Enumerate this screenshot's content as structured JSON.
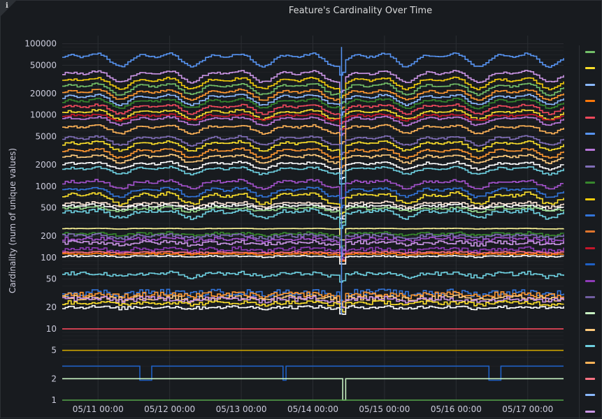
{
  "panel": {
    "title": "Feature's Cardinality Over Time",
    "info_icon": "i"
  },
  "chart_data": {
    "type": "line",
    "title": "Feature's Cardinality Over Time",
    "xlabel": "",
    "ylabel": "Cardinality (num of unique values)",
    "yscale": "log",
    "ylim": [
      1,
      130000
    ],
    "yticks": [
      1,
      2,
      5,
      10,
      20,
      50,
      100,
      200,
      500,
      1000,
      2000,
      5000,
      10000,
      20000,
      50000,
      100000
    ],
    "ytick_labels": [
      "1",
      "2",
      "5",
      "10",
      "20",
      "50",
      "100",
      "200",
      "500",
      "1000",
      "2000",
      "5000",
      "10000",
      "20000",
      "50000",
      "100000"
    ],
    "x_start": "05/10 12:00",
    "xlim_days": [
      0,
      7.0
    ],
    "xticks": [
      {
        "label": "05/11 00:00",
        "day": 0.5
      },
      {
        "label": "05/12 00:00",
        "day": 1.5
      },
      {
        "label": "05/13 00:00",
        "day": 2.5
      },
      {
        "label": "05/14 00:00",
        "day": 3.5
      },
      {
        "label": "05/15 00:00",
        "day": 4.5
      },
      {
        "label": "05/16 00:00",
        "day": 5.5
      },
      {
        "label": "05/17 00:00",
        "day": 6.5
      }
    ],
    "grid": true,
    "legend": "right",
    "series": [
      {
        "color": "#5794f2",
        "base": 62000,
        "amp": 0.26,
        "noise": 0.03
      },
      {
        "color": "#ca95e5",
        "base": 36000,
        "amp": 0.22,
        "noise": 0.03
      },
      {
        "color": "#f2cc0c",
        "base": 29000,
        "amp": 0.22,
        "noise": 0.03
      },
      {
        "color": "#73bf69",
        "base": 24000,
        "amp": 0.22,
        "noise": 0.03
      },
      {
        "color": "#ff9830",
        "base": 20000,
        "amp": 0.2,
        "noise": 0.03
      },
      {
        "color": "#8ab8ff",
        "base": 17000,
        "amp": 0.2,
        "noise": 0.03
      },
      {
        "color": "#37872d",
        "base": 15000,
        "amp": 0.18,
        "noise": 0.03
      },
      {
        "color": "#f2495c",
        "base": 12500,
        "amp": 0.18,
        "noise": 0.03
      },
      {
        "color": "#fade2a",
        "base": 10500,
        "amp": 0.18,
        "noise": 0.03
      },
      {
        "color": "#c4162a",
        "base": 9500,
        "amp": 0.12,
        "noise": 0.03
      },
      {
        "color": "#b877d9",
        "base": 8500,
        "amp": 0.16,
        "noise": 0.03
      },
      {
        "color": "#ffb357",
        "base": 6500,
        "amp": 0.16,
        "noise": 0.03
      },
      {
        "color": "#806eb7",
        "base": 4500,
        "amp": 0.18,
        "noise": 0.03
      },
      {
        "color": "#fade2a",
        "base": 3800,
        "amp": 0.18,
        "noise": 0.03
      },
      {
        "color": "#ff9830",
        "base": 3000,
        "amp": 0.18,
        "noise": 0.03
      },
      {
        "color": "#ffcb7d",
        "base": 2500,
        "amp": 0.16,
        "noise": 0.03
      },
      {
        "color": "#ffffff",
        "base": 2000,
        "amp": 0.14,
        "noise": 0.03
      },
      {
        "color": "#6ed0e0",
        "base": 1700,
        "amp": 0.14,
        "noise": 0.03
      },
      {
        "color": "#a352cc",
        "base": 1100,
        "amp": 0.16,
        "noise": 0.04
      },
      {
        "color": "#3274d9",
        "base": 850,
        "amp": 0.18,
        "noise": 0.04
      },
      {
        "color": "#fade2a",
        "base": 700,
        "amp": 0.22,
        "noise": 0.05
      },
      {
        "color": "#f9e2d2",
        "base": 560,
        "amp": 0.1,
        "noise": 0.04
      },
      {
        "color": "#ffffff",
        "base": 520,
        "amp": 0.1,
        "noise": 0.04
      },
      {
        "color": "#96d98d",
        "base": 480,
        "amp": 0.08,
        "noise": 0.04
      },
      {
        "color": "#6ed0e0",
        "base": 420,
        "amp": 0.16,
        "noise": 0.05
      },
      {
        "color": "#fff899",
        "base": 255,
        "amp": 0.01,
        "noise": 0.005
      },
      {
        "color": "#37872d",
        "base": 215,
        "amp": 0.05,
        "noise": 0.04
      },
      {
        "color": "#806eb7",
        "base": 200,
        "amp": 0.06,
        "noise": 0.05
      },
      {
        "color": "#a352cc",
        "base": 180,
        "amp": 0.05,
        "noise": 0.05
      },
      {
        "color": "#ca95e5",
        "base": 160,
        "amp": 0.05,
        "noise": 0.06
      },
      {
        "color": "#8f3bb8",
        "base": 130,
        "amp": 0.05,
        "noise": 0.06
      },
      {
        "color": "#ff7383",
        "base": 118,
        "amp": 0.02,
        "noise": 0.02
      },
      {
        "color": "#ff780a",
        "base": 112,
        "amp": 0.02,
        "noise": 0.02
      },
      {
        "color": "#ffffff",
        "base": 104,
        "amp": 0.02,
        "noise": 0.02
      },
      {
        "color": "#6ed0e0",
        "base": 58,
        "amp": 0.08,
        "noise": 0.06
      },
      {
        "color": "#3274d9",
        "base": 32,
        "amp": 0.05,
        "noise": 0.1
      },
      {
        "color": "#ff9830",
        "base": 30,
        "amp": 0.05,
        "noise": 0.08
      },
      {
        "color": "#ffcb7d",
        "base": 27,
        "amp": 0.04,
        "noise": 0.08
      },
      {
        "color": "#ca95e5",
        "base": 26,
        "amp": 0.04,
        "noise": 0.08
      },
      {
        "color": "#fade2a",
        "base": 23,
        "amp": 0.04,
        "noise": 0.06
      },
      {
        "color": "#ffffff",
        "base": 20,
        "amp": 0.03,
        "noise": 0.05
      },
      {
        "color": "#f2495c",
        "base": 10,
        "amp": 0,
        "noise": 0
      },
      {
        "color": "#cca300",
        "base": 5,
        "amp": 0,
        "noise": 0
      },
      {
        "color": "#1f60c4",
        "base": 3,
        "amp": 0,
        "noise": 0
      },
      {
        "color": "#c8f2c2",
        "base": 2,
        "amp": 0,
        "noise": 0
      },
      {
        "color": "#56a64b",
        "base": 1,
        "amp": 0,
        "noise": 0
      }
    ]
  },
  "legend_colors": [
    "#73bf69",
    "#fade2a",
    "#8ab8ff",
    "#ff780a",
    "#f2495c",
    "#5794f2",
    "#b877d9",
    "#806eb7",
    "#37872d",
    "#f2cc0c",
    "#3274d9",
    "#e0752d",
    "#c4162a",
    "#1f60c4",
    "#8f3bb8",
    "#705da0",
    "#c8f2c2",
    "#ffcb7d",
    "#6ed0e0",
    "#ffb357",
    "#ff7383",
    "#8ab8ff",
    "#ca95e5"
  ]
}
